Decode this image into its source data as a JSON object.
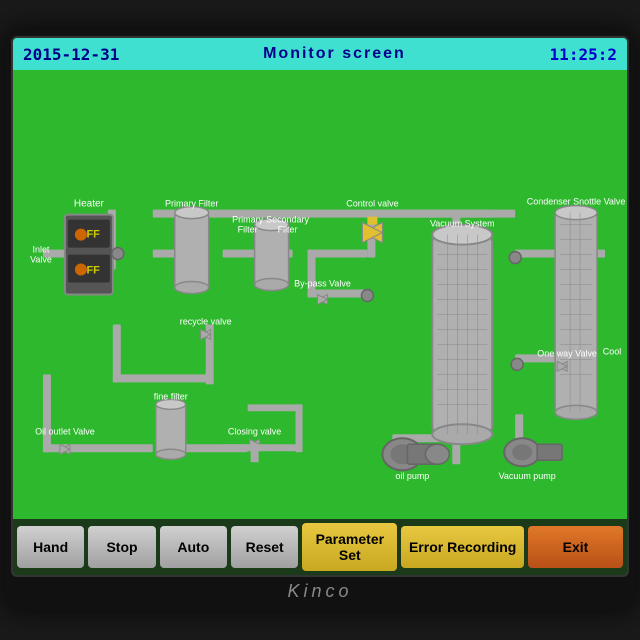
{
  "header": {
    "date": "2015-12-31",
    "title": "Monitor screen",
    "time": "11:25:2"
  },
  "buttons": [
    {
      "id": "hand",
      "label": "Hand",
      "style": "gray"
    },
    {
      "id": "stop",
      "label": "Stop",
      "style": "gray"
    },
    {
      "id": "auto",
      "label": "Auto",
      "style": "gray"
    },
    {
      "id": "reset",
      "label": "Reset",
      "style": "gray"
    },
    {
      "id": "parameter-set",
      "label": "Parameter Set",
      "style": "yellow"
    },
    {
      "id": "error-recording",
      "label": "Error Recording",
      "style": "yellow-wide"
    },
    {
      "id": "exit",
      "label": "Exit",
      "style": "orange"
    }
  ],
  "diagram": {
    "labels": {
      "heater": "Heater",
      "primary_filter": "Primary Filter",
      "primary_filter2": "Primary Filter",
      "secondary_filter": "Secondary Filter",
      "control_valve": "Control valve",
      "vacuum_system": "Vacuum System",
      "condenser": "Condenser",
      "snottle_valve": "Snottle Valve",
      "bypass_valve": "By-pass Valve",
      "recycle_valve": "recycle valve",
      "fine_filter": "fine filter",
      "closing_valve": "Closing valve",
      "oil_outlet_valve": "Oil outlet Valve",
      "oil_pump": "oil pump",
      "vacuum_pump": "Vacuum pump",
      "one_way_valve": "One way Valve",
      "cool": "Cool",
      "inlet_valve": "Inlet valve",
      "off1": "OFF",
      "off2": "OFF"
    }
  },
  "brand": "Kinco"
}
